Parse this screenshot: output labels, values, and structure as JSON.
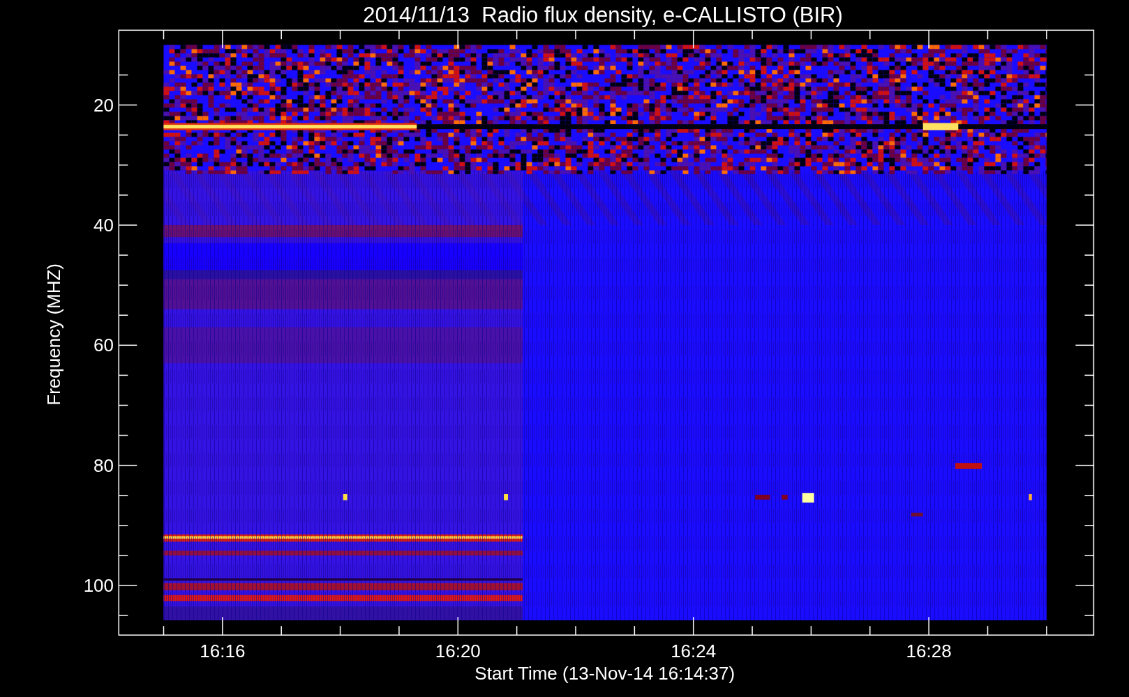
{
  "chart": {
    "title": "2014/11/13  Radio flux density, e-CALLISTO (BIR)",
    "xlabel": "Start Time (13-Nov-14 16:14:37)",
    "ylabel": "Frequency (MHZ)",
    "xtick_labels": [
      "16:16",
      "16:20",
      "16:24",
      "16:28"
    ],
    "ytick_labels": [
      "20",
      "40",
      "60",
      "80",
      "100"
    ]
  }
}
